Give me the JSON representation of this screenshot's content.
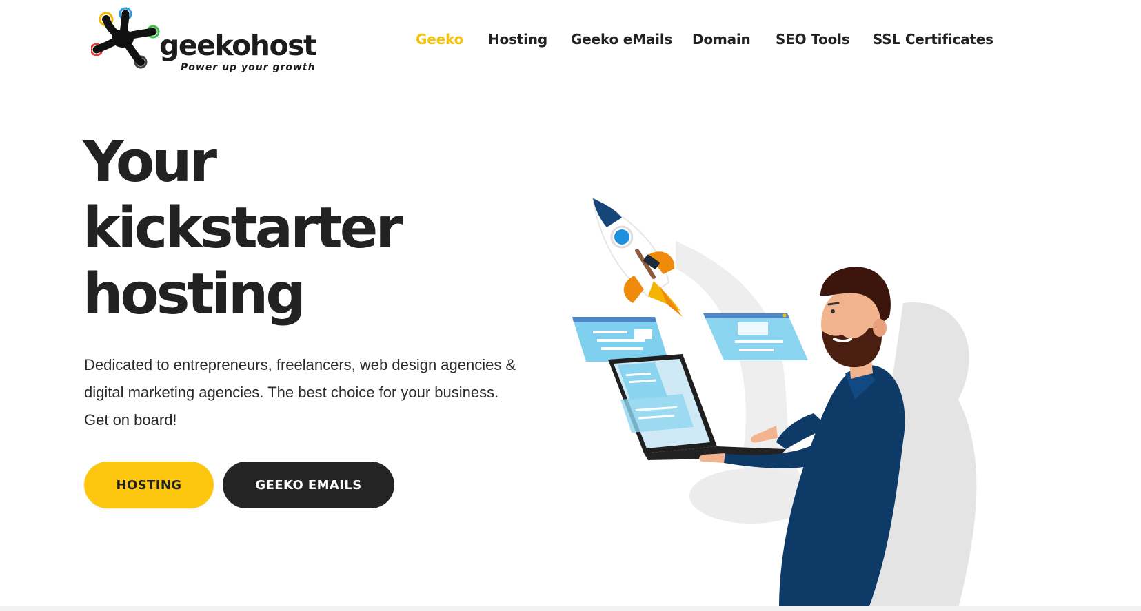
{
  "brand": {
    "name": "geekohost",
    "tagline": "Power up your growth",
    "colors": {
      "accent": "#fdc70f",
      "dark": "#242424",
      "text": "#222222",
      "navy": "#0d3a66",
      "sky": "#7fd0ee"
    }
  },
  "nav": {
    "items": [
      {
        "label": "Geeko",
        "active": true
      },
      {
        "label": "Hosting",
        "active": false
      },
      {
        "label": "Geeko eMails",
        "active": false
      },
      {
        "label": "Domain",
        "active": false
      },
      {
        "label": "SEO Tools",
        "active": false
      },
      {
        "label": "SSL Certificates",
        "active": false
      }
    ]
  },
  "hero": {
    "title_lines": [
      "Your",
      "kickstarter",
      "hosting"
    ],
    "description": "Dedicated to entrepreneurs, freelancers, web design agencies & digital marketing agencies. The best choice for your business. Get on board!",
    "buttons": {
      "primary": "HOSTING",
      "secondary": "GEEKO EMAILS"
    }
  },
  "illustration": {
    "subject": "man with laptop launching rocket",
    "icons": [
      "rocket-icon",
      "laptop-icon",
      "browser-window-icon"
    ]
  }
}
